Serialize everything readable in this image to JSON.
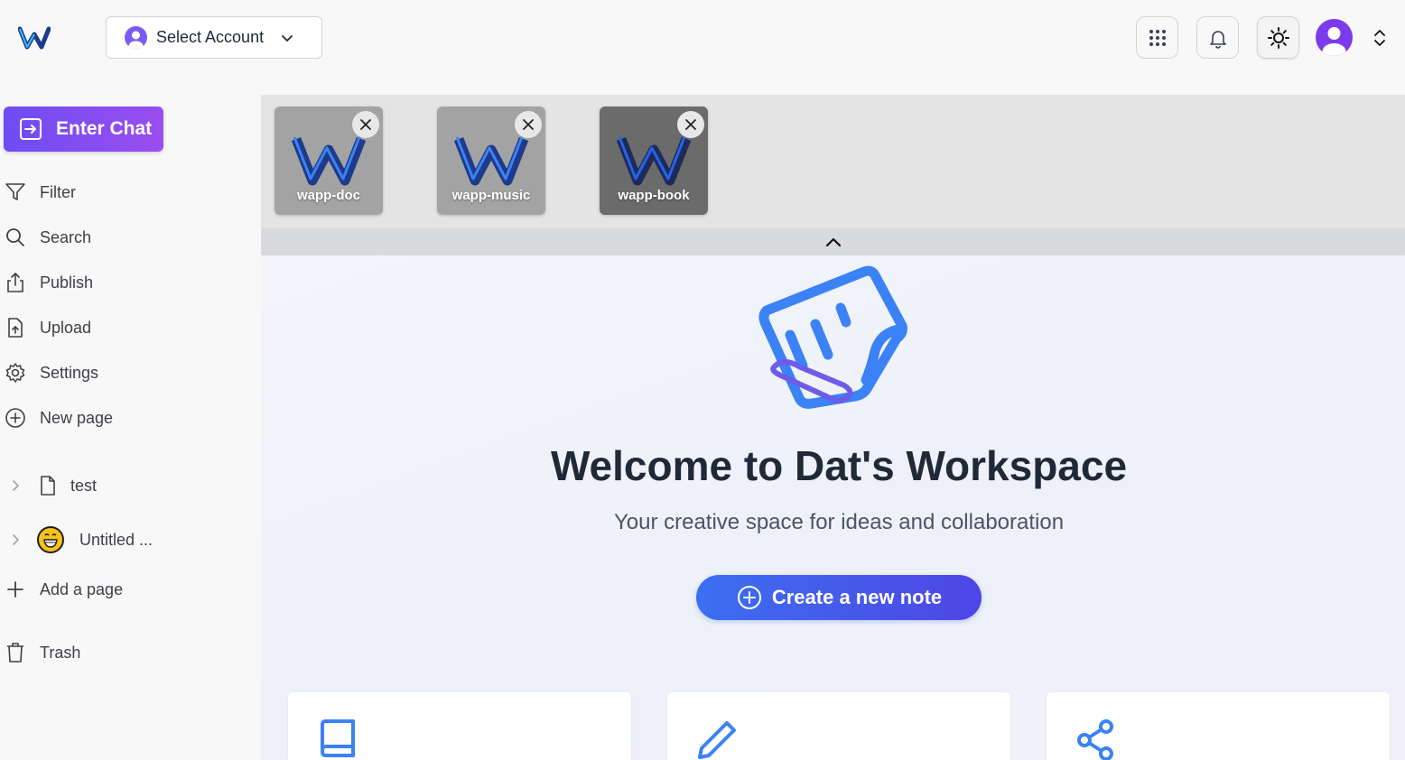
{
  "topbar": {
    "account_select": {
      "label": "Select Account",
      "icon": "user-circle-icon"
    },
    "buttons": [
      {
        "name": "apps-grid",
        "icon": "grid-icon"
      },
      {
        "name": "notifications",
        "icon": "bell-icon"
      },
      {
        "name": "theme-toggle",
        "icon": "sun-icon"
      }
    ],
    "profile": {
      "icon": "user-avatar-icon"
    }
  },
  "sidebar": {
    "enter_chat": "Enter Chat",
    "items": [
      {
        "label": "Filter",
        "icon": "filter-icon"
      },
      {
        "label": "Search",
        "icon": "search-icon"
      },
      {
        "label": "Publish",
        "icon": "share-upload-icon"
      },
      {
        "label": "Upload",
        "icon": "file-upload-icon"
      },
      {
        "label": "Settings",
        "icon": "gear-icon"
      },
      {
        "label": "New page",
        "icon": "plus-circle-icon"
      }
    ],
    "pages": [
      {
        "label": "test",
        "icon": "document-icon"
      },
      {
        "label": "Untitled ...",
        "icon": "grinning-emoji-icon"
      }
    ],
    "add_page": "Add a page",
    "trash": "Trash"
  },
  "apps": [
    {
      "label": "wapp-doc",
      "color": "#a3a3a3"
    },
    {
      "label": "wapp-music",
      "color": "#a3a3a3"
    },
    {
      "label": "wapp-book",
      "color": "#6b6b6b"
    }
  ],
  "main": {
    "welcome": "Welcome to Dat's Workspace",
    "tagline": "Your creative space for ideas and collaboration",
    "create_button": "Create a new note",
    "cards": [
      {
        "icon": "book-icon"
      },
      {
        "icon": "pencil-icon"
      },
      {
        "icon": "share-nodes-icon"
      }
    ]
  },
  "colors": {
    "accent": "#3b6ff0",
    "purple": "#7c3aed",
    "enter_chat_start": "#6d4df2",
    "enter_chat_end": "#9b4df0"
  }
}
